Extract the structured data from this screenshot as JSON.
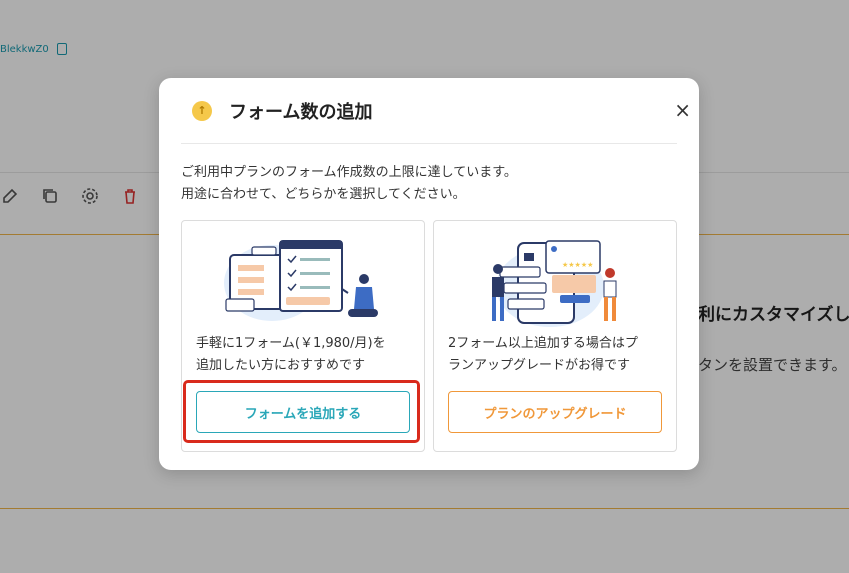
{
  "background": {
    "id_text": "BlekkwZ0",
    "heading_partial": "利にカスタマイズし",
    "sub_partial": "タンを設置できます。"
  },
  "modal": {
    "title": "フォーム数の追加",
    "close_label": "×",
    "description_line1": "ご利用中プランのフォーム作成数の上限に達しています。",
    "description_line2": "用途に合わせて、どちらかを選択してください。",
    "options": [
      {
        "text_line1": "手軽に1フォーム(￥1,980/月)を",
        "text_line2": "追加したい方におすすめです",
        "button_label": "フォームを追加する"
      },
      {
        "text_line1": "2フォーム以上追加する場合はプ",
        "text_line2": "ランアップグレードがお得です",
        "button_label": "プランのアップグレード"
      }
    ]
  },
  "colors": {
    "teal": "#2aa7b8",
    "orange": "#f0983a",
    "highlight": "#d92a1c",
    "title_icon": "#f5c84a"
  }
}
